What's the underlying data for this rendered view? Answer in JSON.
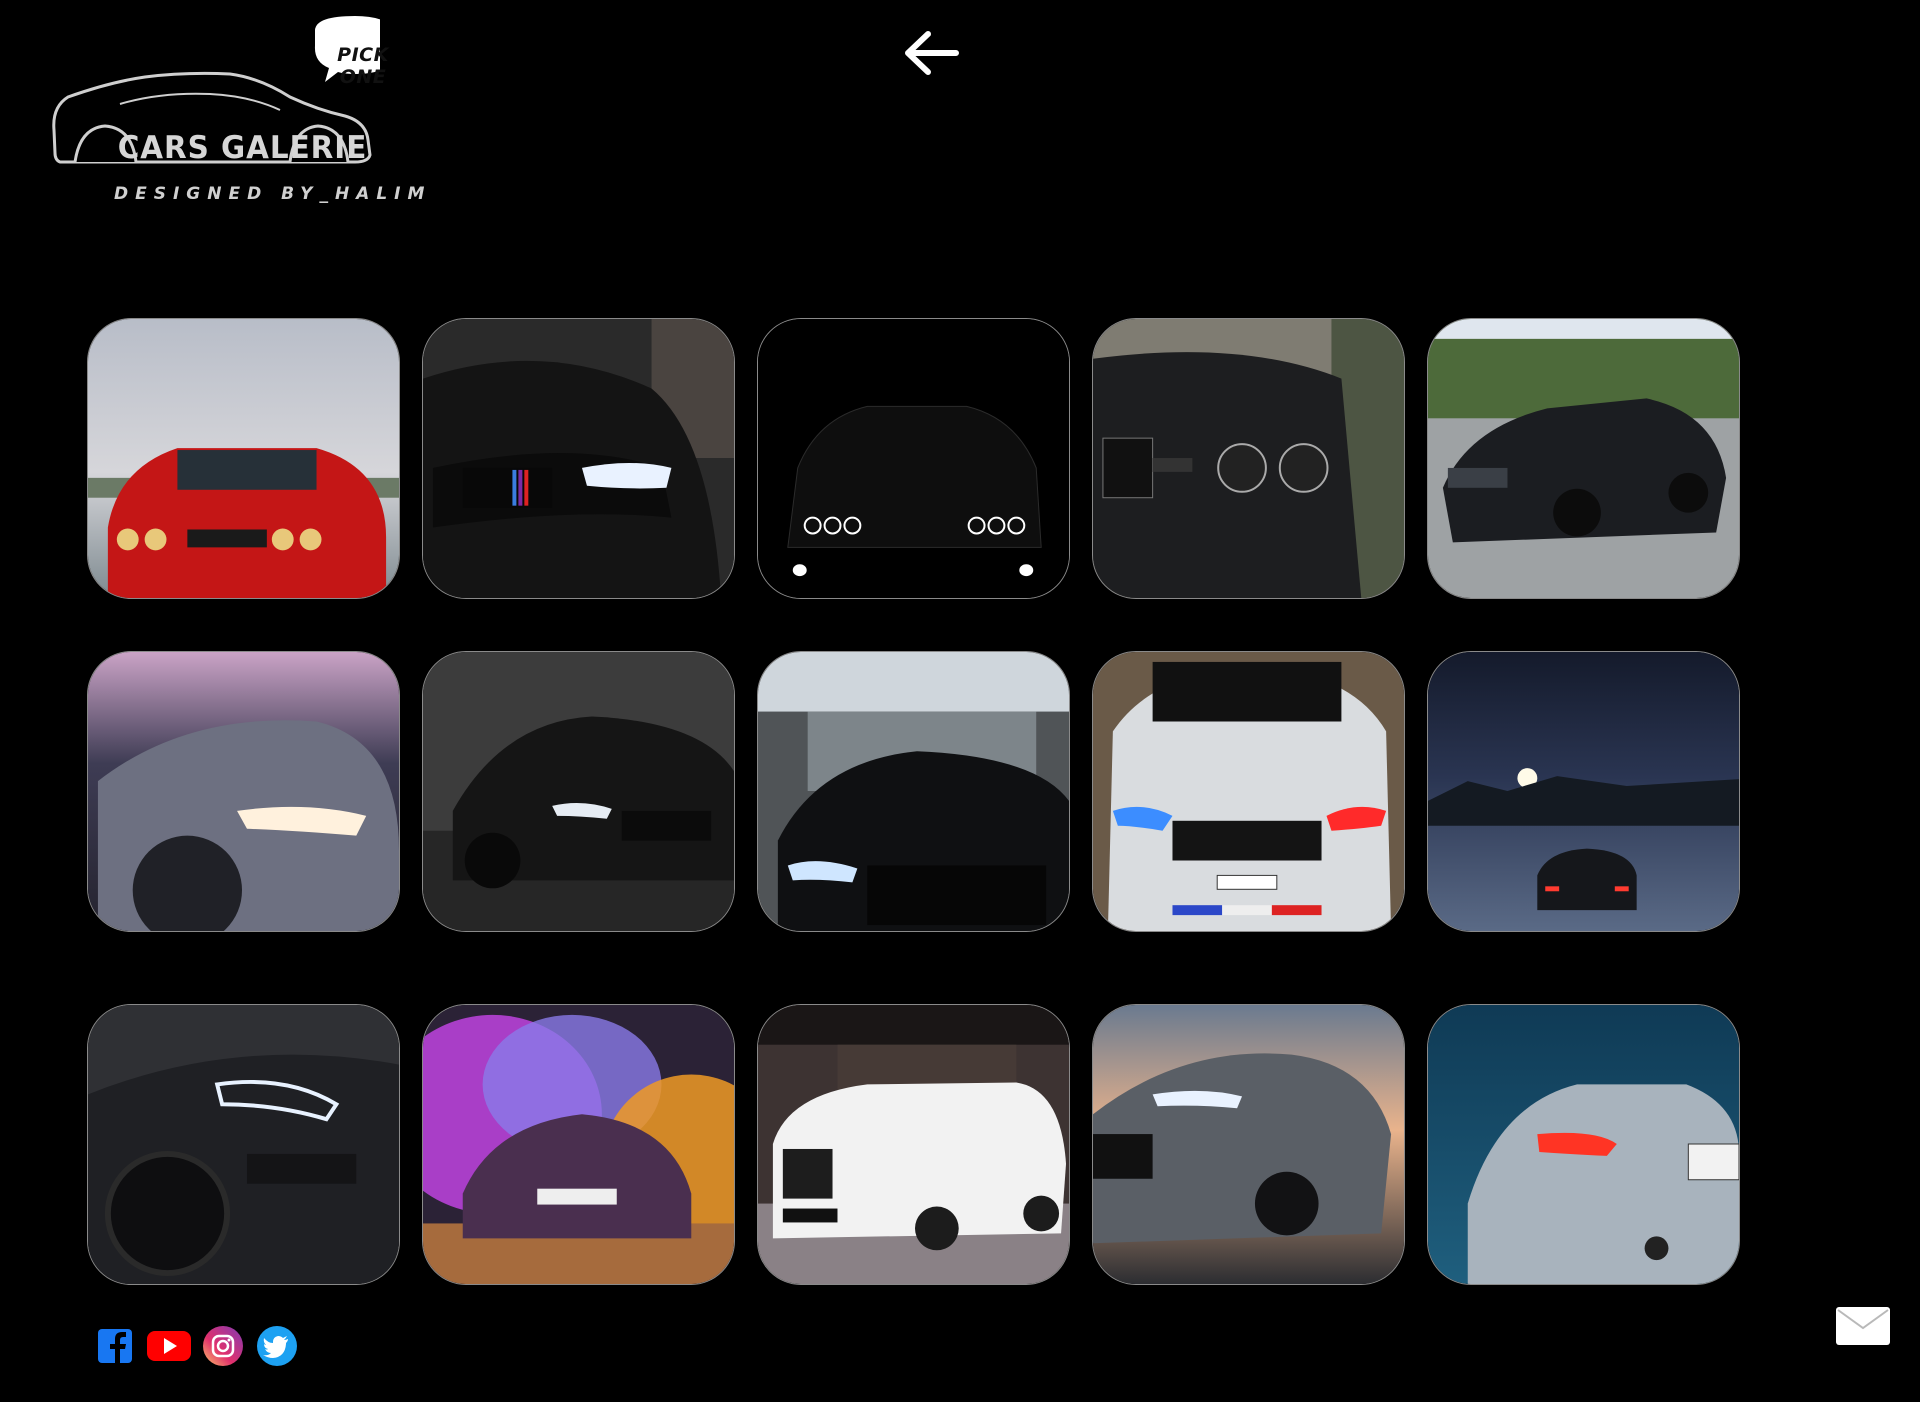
{
  "logo": {
    "bubble_text": "PICK ONE",
    "title": "CARS GALERIE",
    "subtitle": "DESIGNED BY_HALIM"
  },
  "nav": {
    "back_icon": "arrow-left-icon"
  },
  "gallery": {
    "items": [
      {
        "name": "gallery-image-red-bmw-m3-e30"
      },
      {
        "name": "gallery-image-black-bmw-m4-headlight"
      },
      {
        "name": "gallery-image-black-bmw-dark-silhouette"
      },
      {
        "name": "gallery-image-black-bmw-m3-e34-front"
      },
      {
        "name": "gallery-image-black-bmw-m5-driveway"
      },
      {
        "name": "gallery-image-grey-bmw-m2-headlight"
      },
      {
        "name": "gallery-image-black-bmw-m8-forest"
      },
      {
        "name": "gallery-image-black-bmw-m8-garage"
      },
      {
        "name": "gallery-image-white-bmw-m5-ice"
      },
      {
        "name": "gallery-image-bmw-night-moon"
      },
      {
        "name": "gallery-image-dark-bmw-headlight-closeup"
      },
      {
        "name": "gallery-image-bmw-purple-smoke"
      },
      {
        "name": "gallery-image-white-bmw-x7-showroom"
      },
      {
        "name": "gallery-image-grey-bmw-m8-sunset"
      },
      {
        "name": "gallery-image-silver-bmw-m4-rear"
      }
    ]
  },
  "footer": {
    "social": [
      "facebook-icon",
      "youtube-icon",
      "instagram-icon",
      "twitter-icon"
    ],
    "mail_icon": "envelope-icon"
  },
  "colors": {
    "background": "#000000",
    "facebook": "#1877f2",
    "youtube": "#ff0000",
    "twitter": "#1da1f2"
  }
}
